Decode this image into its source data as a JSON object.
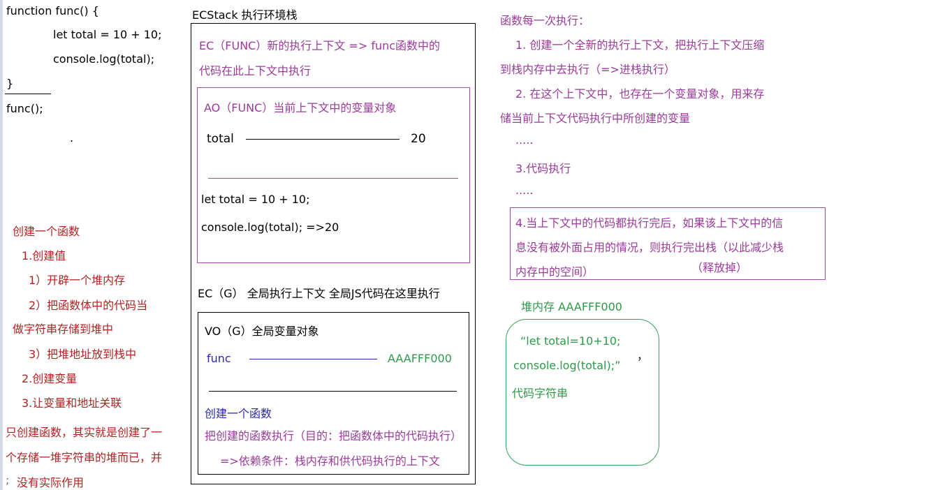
{
  "code": {
    "line1": "function func() {",
    "line2": "let total = 10 + 10;",
    "line3": "console.log(total);",
    "line4": "}",
    "line5": "func();",
    "dot": "."
  },
  "create_function": {
    "title": "创建一个函数",
    "step1": "1.创建值",
    "step1_1": "1）开辟一个堆内存",
    "step1_2a": "2）把函数体中的代码当",
    "step1_2b": "做字符串存储到堆中",
    "step1_3": "3）把堆地址放到栈中",
    "step2": "2.创建变量",
    "step3": "3.让变量和地址关联",
    "summary1": "只创建函数，其实就是创建了一",
    "summary2": "个存储一堆字符串的堆而已，并",
    "summary3": "没有实际作用",
    "summary_mark": ";"
  },
  "ecstack": {
    "title": "ECStack 执行环境栈",
    "ec_func_line1": "EC（FUNC）新的执行上下文  => func函数中的",
    "ec_func_line2": "代码在此上下文中执行",
    "ao_title": "AO（FUNC）当前上下文中的变量对象",
    "ao_var": "total",
    "ao_val": "20",
    "ao_code1": "let total = 10 + 10;",
    "ao_code2": "console.log(total);  =>20",
    "ec_g_title": "EC（G） 全局执行上下文     全局JS代码在这里执行",
    "vo_title": "VO（G）全局变量对象",
    "vo_var": "func",
    "vo_val": "AAAFFF000",
    "vo_note1": "创建一个函数",
    "vo_note2": "把创建的函数执行（目的：把函数体中的代码执行）",
    "vo_note3": "=>依赖条件：栈内存和供代码执行的上下文"
  },
  "right_notes": {
    "title": "函数每一次执行：",
    "n1a": "1. 创建一个全新的执行上下文，把执行上下文压缩",
    "n1b": "到栈内存中去执行（=>进栈执行）",
    "n2a": "2. 在这个上下文中，也存在一个变量对象，用来存",
    "n2b": "储当前上下文代码执行中所创建的变量",
    "dots1": ".....",
    "n3": "3.代码执行",
    "dots2": ".....",
    "n4a": "4.当上下文中的代码都执行完后，如果该上下文中的信",
    "n4b": "息没有被外面占用的情况，则执行完出栈（以此减少栈",
    "n4c": "内存中的空间）",
    "n4d": "（释放掉）"
  },
  "heap": {
    "title": "堆内存  AAAFFF000",
    "line1": "“let total=10+10;",
    "line2": "console.log(total);”",
    "line3": "代码字符串",
    "mark": "，"
  },
  "colors": {
    "red": "#b22222",
    "purple": "#9b3b9b",
    "blue": "#2a2aa8",
    "green": "#2e9a4a"
  }
}
